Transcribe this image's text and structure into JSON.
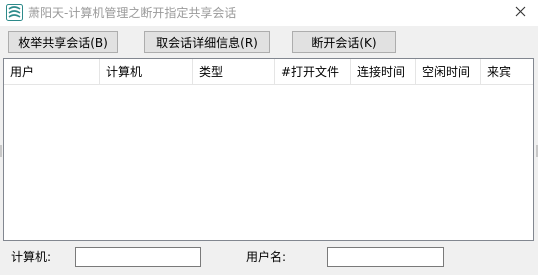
{
  "window": {
    "title": "萧阳天-计算机管理之断开指定共享会话",
    "close_label": "✕"
  },
  "toolbar": {
    "enumerate_label": "枚举共享会话(B)",
    "details_label": "取会话详细信息(R)",
    "disconnect_label": "断开会话(K)"
  },
  "list": {
    "columns": [
      "用户",
      "计算机",
      "类型",
      "#打开文件",
      "连接时间",
      "空闲时间",
      "来宾"
    ],
    "rows": []
  },
  "filters": {
    "computer_label": "计算机:",
    "computer_value": "",
    "user_label": "用户名:",
    "user_value": ""
  },
  "icons": {
    "app": "app-logo-icon",
    "close": "close-icon"
  }
}
